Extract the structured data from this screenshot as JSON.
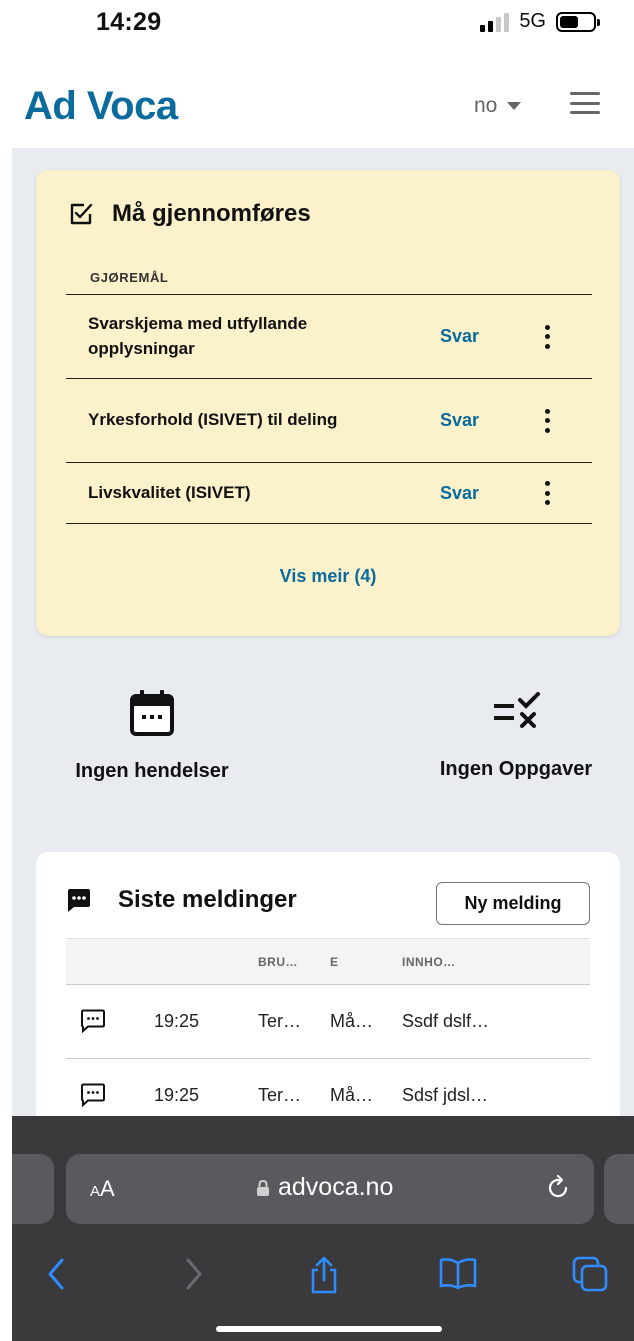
{
  "status_bar": {
    "time": "14:29",
    "network": "5G"
  },
  "header": {
    "brand": "Ad Voca",
    "language": "no"
  },
  "todo": {
    "title": "Må gjennomføres",
    "section_label": "GJØREMÅL",
    "items": [
      {
        "name": "Svarskjema med utfyllande opplysningar",
        "action": "Svar"
      },
      {
        "name": "Yrkesforhold (ISIVET) til deling",
        "action": "Svar"
      },
      {
        "name": "Livskvalitet (ISIVET)",
        "action": "Svar"
      }
    ],
    "show_more": "Vis meir (4)"
  },
  "summary": {
    "events": "Ingen hendelser",
    "tasks": "Ingen Oppgaver"
  },
  "messages": {
    "title": "Siste meldinger",
    "new_button": "Ny melding",
    "columns": [
      "BRU…",
      "E",
      "INNHO…"
    ],
    "rows": [
      {
        "time": "19:25",
        "user": "Ter…",
        "subject": "Må…",
        "content": "Ssdf dslf…"
      },
      {
        "time": "19:25",
        "user": "Ter…",
        "subject": "Må…",
        "content": "Sdsf jdsl…"
      }
    ]
  },
  "browser": {
    "text_size_label_small": "A",
    "text_size_label_large": "A",
    "url": "advoca.no"
  },
  "colors": {
    "brand": "#0a6b9c",
    "todo_card": "#fbf1cb",
    "background": "#e8ebef",
    "safari_bar": "#3a3a3c"
  }
}
